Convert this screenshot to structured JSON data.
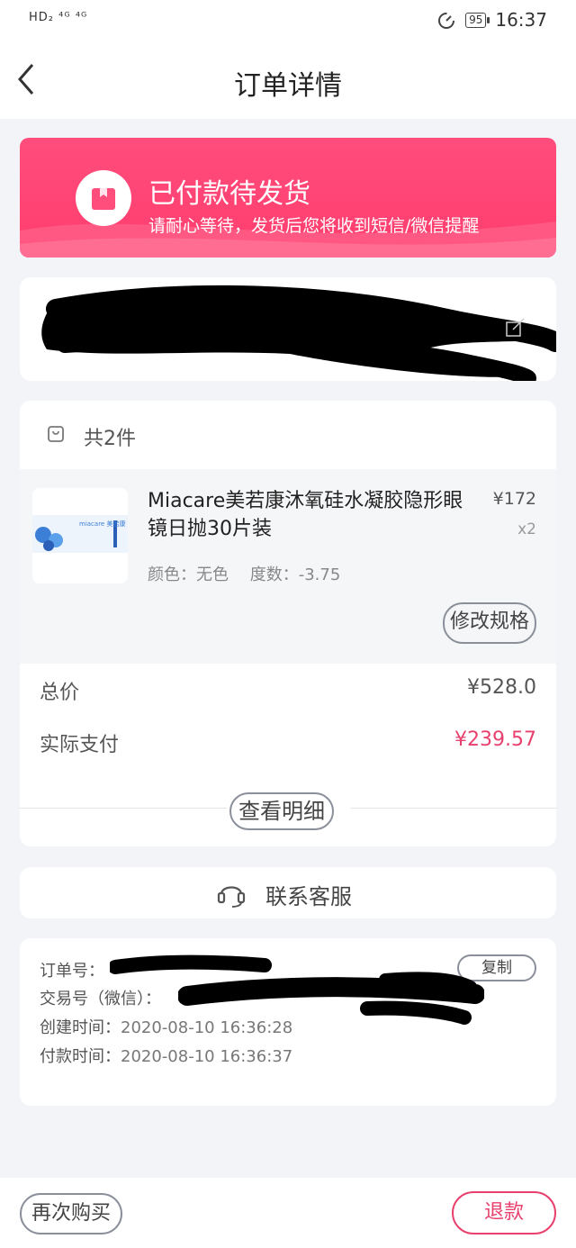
{
  "status_bar": {
    "network": "HD₂ ⁴ᴳ ⁴ᴳ",
    "battery": "95",
    "time": "16:37"
  },
  "nav": {
    "title": "订单详情"
  },
  "banner": {
    "title": "已付款待发货",
    "subtitle": "请耐心等待，发货后您将收到短信/微信提醒"
  },
  "goods": {
    "count_label": "共2件",
    "item": {
      "name": "Miacare美若康沐氧硅水凝胶隐形眼镜日抛30片装",
      "price": "¥172",
      "qty": "x2",
      "spec_color": "颜色：无色",
      "spec_power": "度数：-3.75",
      "thumb_brand": "miacare 美若康",
      "modify_label": "修改规格"
    },
    "total_label": "总价",
    "total_value": "¥528.0",
    "paid_label": "实际支付",
    "paid_value": "¥239.57",
    "detail_label": "查看明细"
  },
  "service": {
    "label": "联系客服"
  },
  "order_info": {
    "order_no_label": "订单号：",
    "copy_label": "复制",
    "trade_no_label": "交易号（微信）：",
    "created_label": "创建时间：",
    "created_value": "2020-08-10 16:36:28",
    "paid_label": "付款时间：",
    "paid_value": "2020-08-10 16:36:37"
  },
  "bottom": {
    "rebuy_label": "再次购买",
    "refund_label": "退款"
  },
  "colors": {
    "accent": "#e8416e",
    "banner": "#ff4d7c",
    "background": "#f3f4f8"
  },
  "icons": [
    "back-arrow-icon",
    "package-icon",
    "edit-icon",
    "bag-icon",
    "headset-icon"
  ]
}
